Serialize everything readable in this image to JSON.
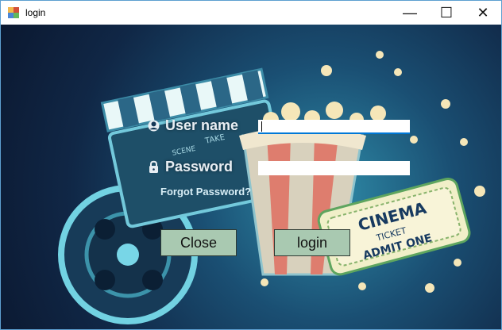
{
  "window": {
    "title": "login"
  },
  "form": {
    "username_label": "User name",
    "username_value": "",
    "password_label": "Password",
    "password_value": "",
    "forgot_text": "Forgot Password?",
    "close_label": "Close",
    "login_label": "login"
  },
  "background": {
    "ticket_line1": "CINEMA",
    "ticket_line2": "TICKET",
    "ticket_line3": "ADMIT ONE",
    "clapper_scene": "SCENE",
    "clapper_take": "TAKE"
  },
  "colors": {
    "button_bg": "#a9c9b1",
    "input_focus": "#0078d7",
    "label_text": "#e8eef3"
  },
  "icons": [
    "app-icon",
    "minimize-icon",
    "maximize-icon",
    "close-icon",
    "user-icon",
    "lock-icon"
  ]
}
